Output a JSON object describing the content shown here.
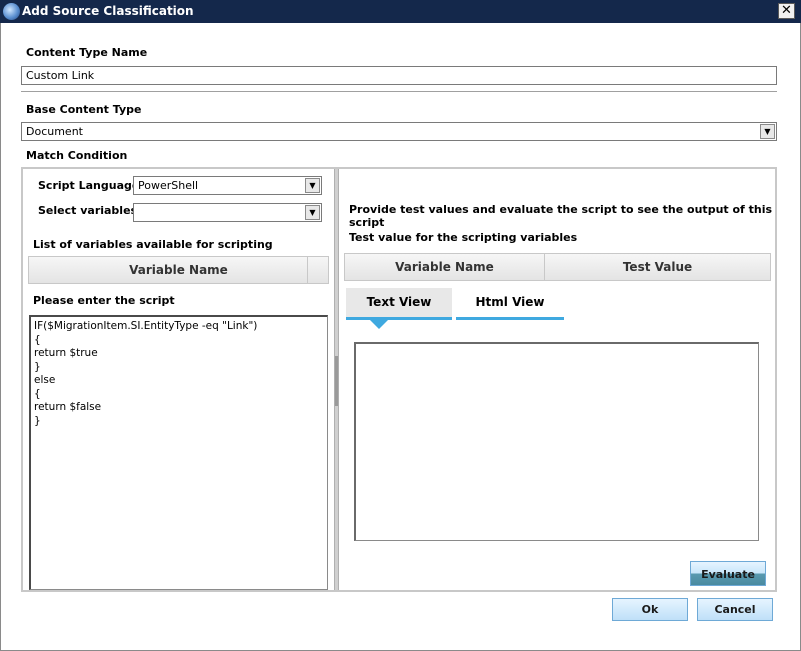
{
  "window": {
    "title": "Add Source Classification",
    "close_glyph": "✕"
  },
  "content_type": {
    "label": "Content Type Name",
    "value": "Custom Link"
  },
  "base_content_type": {
    "label": "Base Content Type",
    "value": "Document"
  },
  "match_condition": {
    "label": "Match Condition"
  },
  "left_panel": {
    "script_language_label": "Script Language",
    "script_language_value": "PowerShell",
    "select_variables_label": "Select variables",
    "select_variables_value": "",
    "variables_list_label": "List of variables available for scripting",
    "variables_header": "Variable Name",
    "script_label": "Please enter the script",
    "script_text": "IF($MigrationItem.SI.EntityType -eq \"Link\")\n{\nreturn $true\n}\nelse\n{\nreturn $false\n}"
  },
  "right_panel": {
    "instructions": "Provide test values and evaluate the script to see the output of this script",
    "test_value_label": "Test value for the scripting variables",
    "col_variable_name": "Variable Name",
    "col_test_value": "Test Value",
    "tabs": [
      {
        "label": "Text View"
      },
      {
        "label": "Html View"
      }
    ],
    "active_tab": "Text View",
    "output_text": "",
    "evaluate_label": "Evaluate"
  },
  "footer": {
    "ok_label": "Ok",
    "cancel_label": "Cancel"
  },
  "colors": {
    "titlebar": "#14284b",
    "tab_accent": "#3fa9e0",
    "button_bg": "#bfe0f8"
  }
}
